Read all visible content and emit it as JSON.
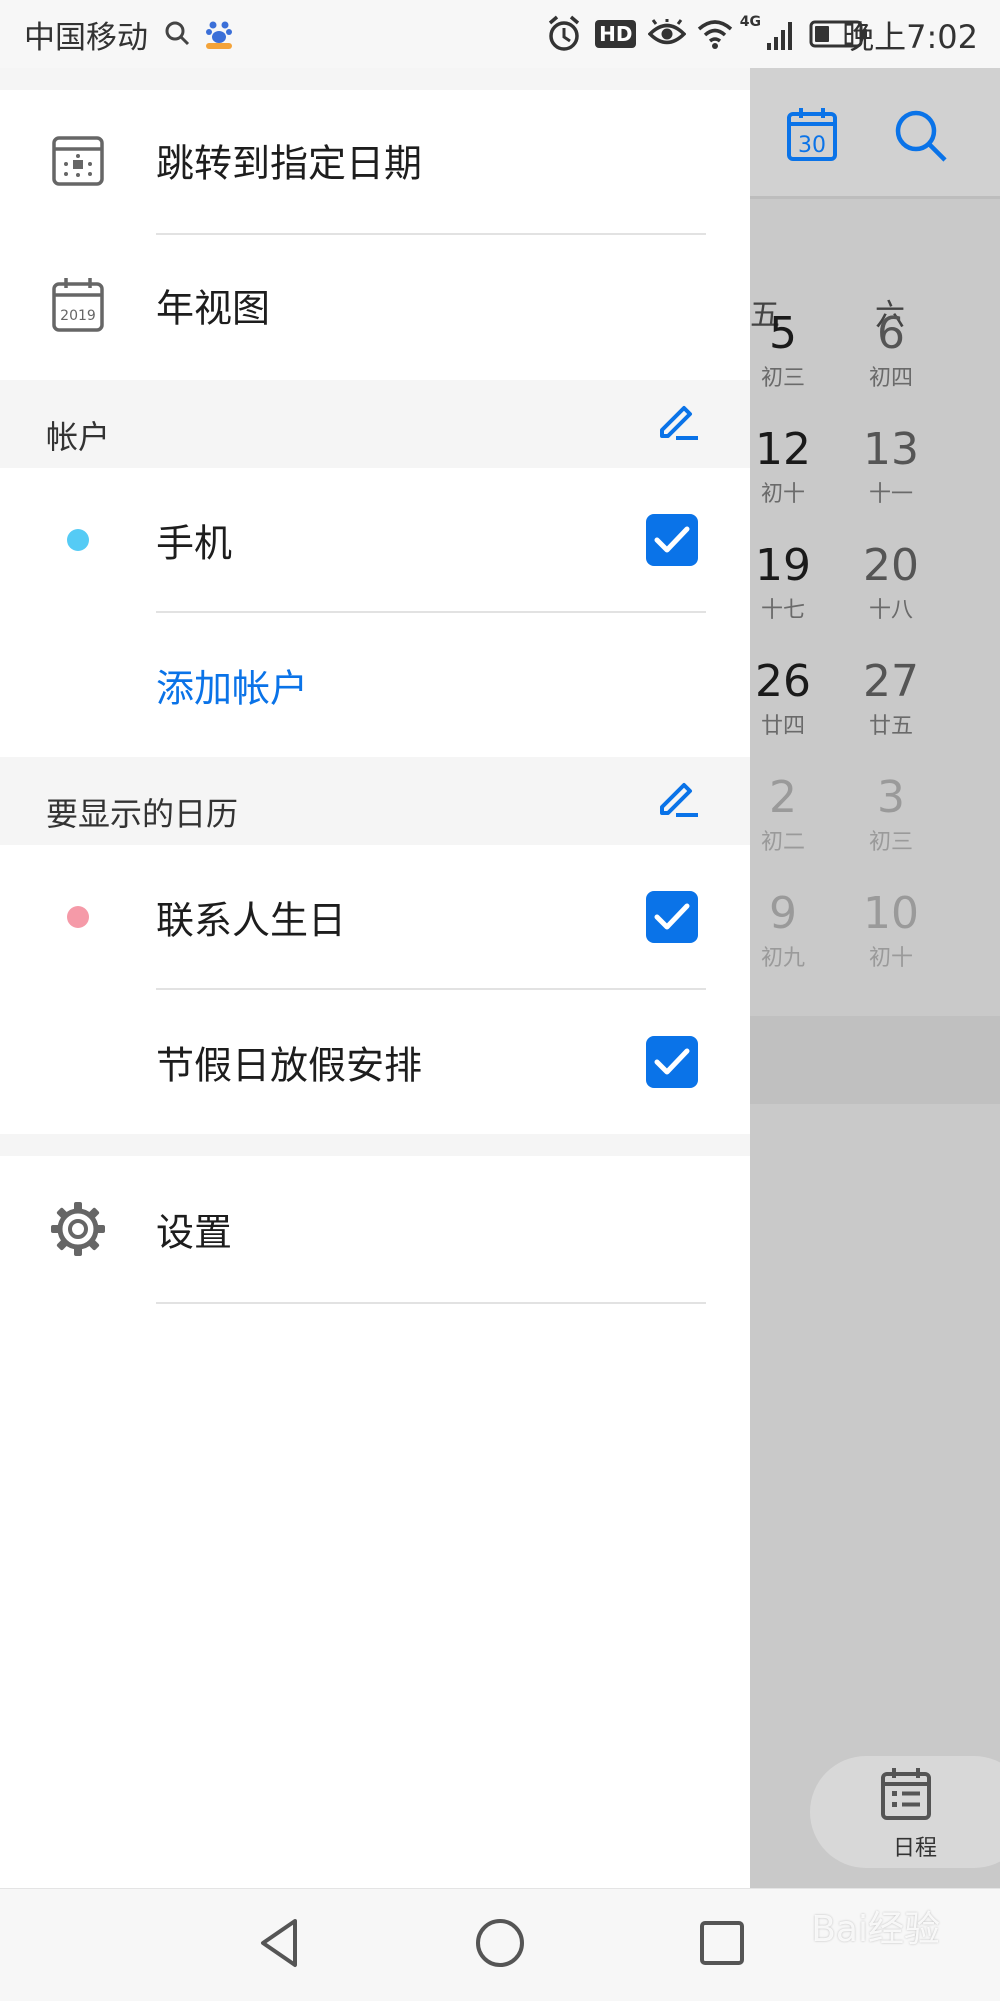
{
  "status_bar": {
    "carrier": "中国移动",
    "time": "晚上7:02",
    "network": "4G",
    "badge": "HD"
  },
  "drawer": {
    "items": [
      {
        "label": "跳转到指定日期",
        "icon": "calendar-goto-icon"
      },
      {
        "label": "年视图",
        "icon": "calendar-year-icon",
        "icon_text": "2019"
      }
    ],
    "accounts_section": {
      "title": "帐户",
      "items": [
        {
          "label": "手机",
          "dot_color": "#55cbf5",
          "checked": true
        }
      ],
      "add_label": "添加帐户"
    },
    "calendars_section": {
      "title": "要显示的日历",
      "items": [
        {
          "label": "联系人生日",
          "dot_color": "#f59aa8",
          "checked": true
        },
        {
          "label": "节假日放假安排",
          "checked": true
        }
      ]
    },
    "settings_label": "设置"
  },
  "background_calendar": {
    "header_calendar_number": "30",
    "weekdays": [
      "五",
      "六"
    ],
    "weeks": [
      {
        "fri": "5",
        "fri_lunar": "初三",
        "sat": "6",
        "sat_lunar": "初四"
      },
      {
        "fri": "12",
        "fri_lunar": "初十",
        "sat": "13",
        "sat_lunar": "十一"
      },
      {
        "fri": "19",
        "fri_lunar": "十七",
        "sat": "20",
        "sat_lunar": "十八"
      },
      {
        "fri": "26",
        "fri_lunar": "廿四",
        "sat": "27",
        "sat_lunar": "廿五"
      },
      {
        "fri": "2",
        "fri_lunar": "初二",
        "sat": "3",
        "sat_lunar": "初三"
      },
      {
        "fri": "9",
        "fri_lunar": "初九",
        "sat": "10",
        "sat_lunar": "初十"
      }
    ],
    "schedule_label": "日程"
  },
  "watermark": "Bai经验",
  "colors": {
    "accent": "#0a73e8",
    "drawer_bg": "#ffffff",
    "section_bg": "#f5f5f5",
    "scrim": "#c9c9c9"
  }
}
